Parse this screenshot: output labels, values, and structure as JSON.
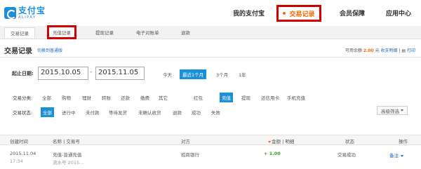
{
  "header": {
    "logo_cn": "支付宝",
    "logo_en": "ALIPAY",
    "nav": {
      "my_alipay": "我的支付宝",
      "transactions": "交易记录",
      "member": "会员保障",
      "apps": "应用中心"
    }
  },
  "subtabs": [
    "交易记录",
    "充值记录",
    "提现记录",
    "电子对账单",
    "退款"
  ],
  "title": {
    "text": "交易记录",
    "switch_link": "切换到普通版",
    "balance_label": "可用余额",
    "balance_amount": "2.00",
    "balance_unit": "元",
    "withdraw_link": "收支明细",
    "print_link": "打印"
  },
  "filters": {
    "date_label": "起止日期:",
    "start_date": "2015.10.05",
    "end_date": "2015.11.05",
    "date_sep": "-",
    "ranges": [
      "今天",
      "最近1个月",
      "3个月",
      "1年"
    ],
    "category_label": "交易分类:",
    "categories": [
      "全部",
      "购物",
      "理财",
      "转账",
      "还款",
      "缴费",
      "其它",
      "红包",
      "充值",
      "提现",
      "还信用卡",
      "手机充值"
    ],
    "status_label": "交易状态:",
    "statuses": [
      "全部",
      "进行中",
      "未付款",
      "等待发货",
      "未确认收货",
      "退款",
      "成功",
      "失败"
    ],
    "advanced": "高级筛选"
  },
  "table": {
    "headers": {
      "created": "创建时间",
      "name": "名称 | 交易号",
      "party": "对方",
      "amount": "金额 | 明细",
      "status": "状态",
      "action": "操作"
    },
    "rows": [
      {
        "date": "2015.11.04",
        "time": "17:34",
        "name": "充值-普通充值",
        "serial": "流水号 2015...",
        "party": "招商银行",
        "amount": "+ 1.00",
        "status": "交易成功",
        "action": "备注"
      }
    ]
  },
  "colors": {
    "brand": "#1b8fd8",
    "accent": "#ff6600",
    "highlight_box": "#d40000",
    "amount_positive": "#3a9d23"
  }
}
